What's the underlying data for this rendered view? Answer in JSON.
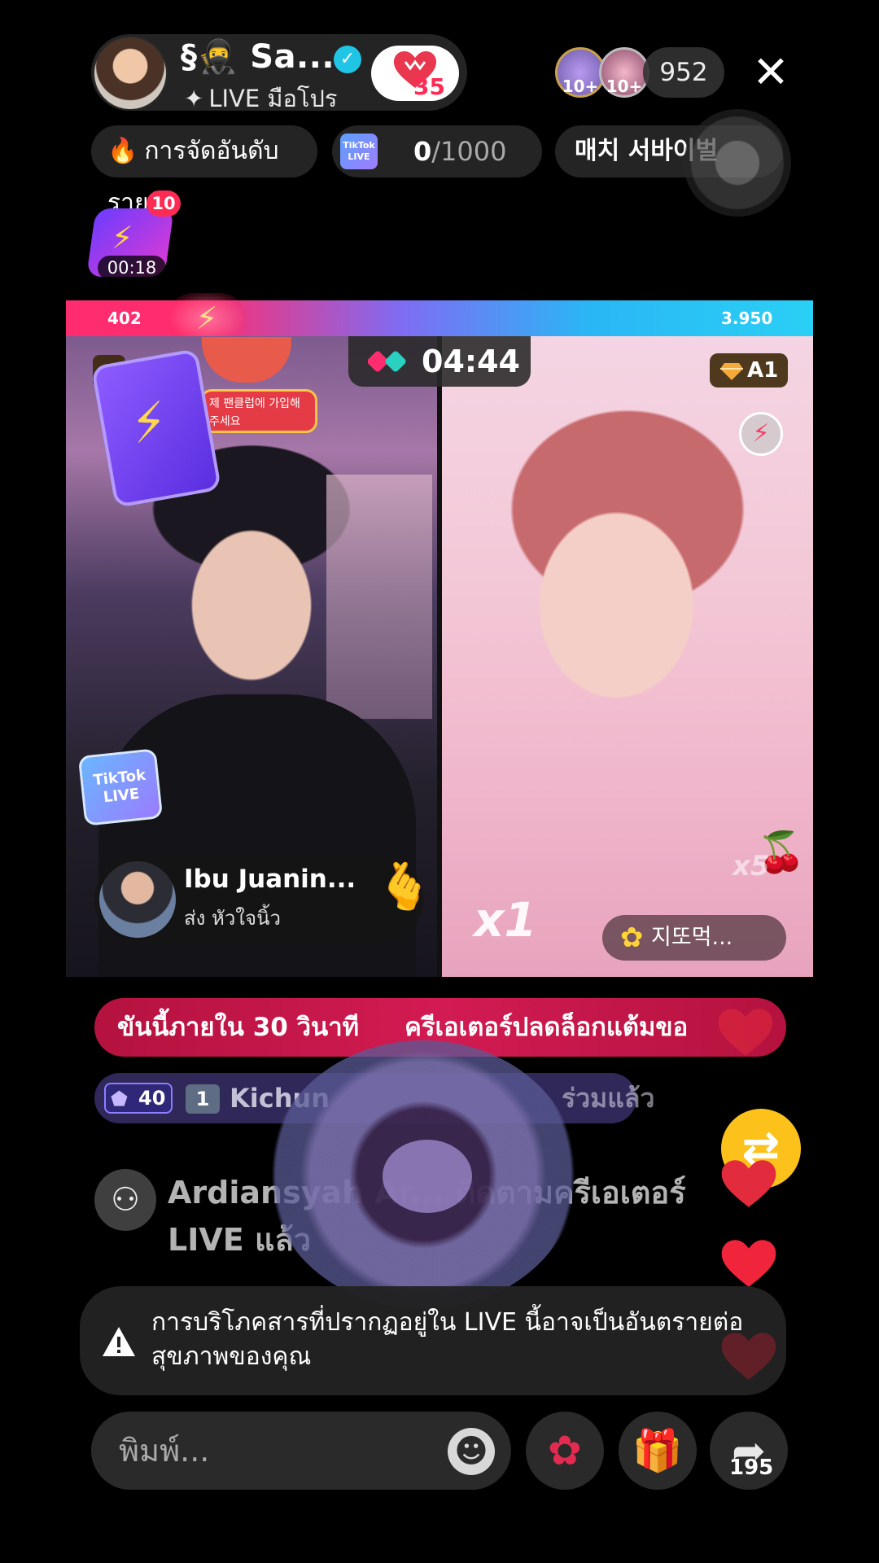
{
  "header": {
    "host_name": "§🥷 Sa...",
    "host_subtitle": "LIVE มือโปร",
    "follow_count": "35",
    "viewer_badge_1": "10+",
    "viewer_badge_2": "10+",
    "viewer_count": "952",
    "icons": {
      "close": "close-icon",
      "verified": "verified-icon",
      "heart": "heart-icon"
    }
  },
  "pills": {
    "daily_ranking": "การจัดอันดับรายวัน",
    "progress_current": "0",
    "progress_max": "/1000",
    "tiktok_badge": "TikTok LIVE",
    "match_label": "매치 서바이벌"
  },
  "gift_timer": {
    "badge": "10",
    "time": "00:18"
  },
  "battle": {
    "score_left": "402",
    "score_right": "3.950",
    "timer": "04:44",
    "right_rank": "A1",
    "left_banner": "제 팬클럽에 가입해주세요",
    "tiktok_live_badge": "TikTok LIVE",
    "multiplier": "x1",
    "streak": "x5",
    "colors": {
      "left": "#ff2d6f",
      "right": "#2ad0f5"
    }
  },
  "gifter": {
    "name": "Ibu Juanin...",
    "action": "ส่ง หัวใจนิ้ว"
  },
  "opponent": {
    "name": "지또먹..."
  },
  "marquee": {
    "part1": "ขันนี้ภายใน 30 วินาที",
    "part2": "ครีเอเตอร์ปลดล็อกแต้มขอ"
  },
  "chat": {
    "join": {
      "level": "40",
      "rank": "1",
      "name": "Kichun",
      "suffix": "ร่วมแล้ว"
    },
    "follow_event": "Ardiansyah Ar... ติดตามครีเอเตอร์ LIVE แล้ว"
  },
  "warning": {
    "text": "การบริโภคสารที่ปรากฏอยู่ใน LIVE นี้อาจเป็นอันตรายต่อสุขภาพของคุณ"
  },
  "bottom": {
    "comment_placeholder": "พิมพ์...",
    "share_count": "195",
    "icons": {
      "emoji": "emoji-icon",
      "rose": "rose-icon",
      "gift": "gift-icon",
      "share": "share-icon"
    }
  }
}
